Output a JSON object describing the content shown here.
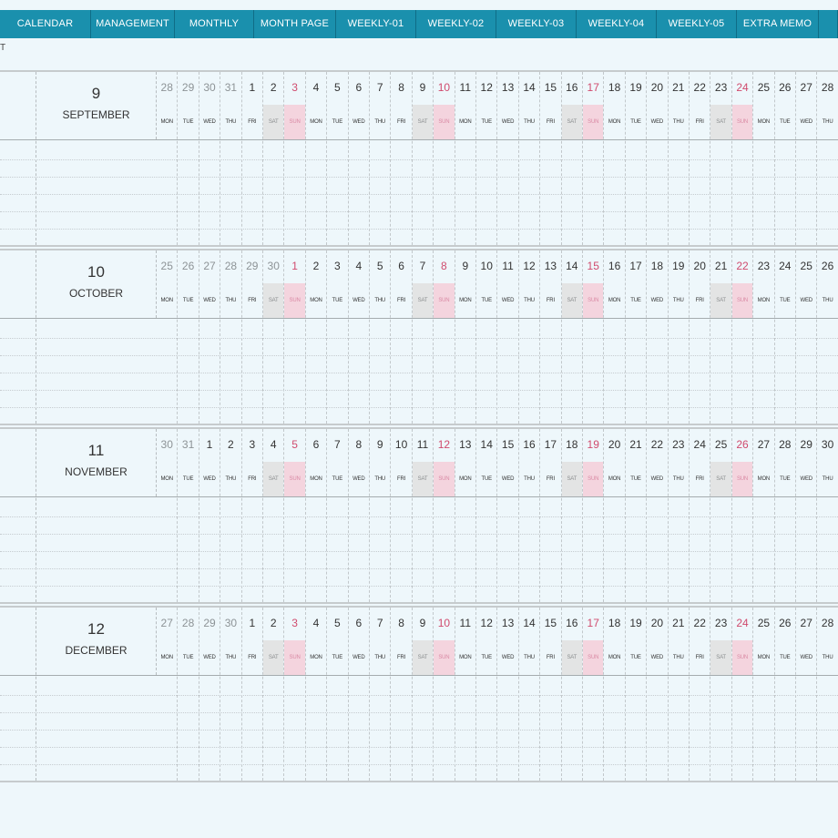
{
  "nav": {
    "tabs": [
      {
        "label": "CALENDAR",
        "w": 100
      },
      {
        "label": "MANAGEMENT",
        "w": 92
      },
      {
        "label": "MONTHLY",
        "w": 87
      },
      {
        "label": "MONTH PAGE",
        "w": 90
      },
      {
        "label": "WEEKLY-01",
        "w": 88
      },
      {
        "label": "WEEKLY-02",
        "w": 88
      },
      {
        "label": "WEEKLY-03",
        "w": 88
      },
      {
        "label": "WEEKLY-04",
        "w": 88
      },
      {
        "label": "WEEKLY-05",
        "w": 88
      },
      {
        "label": "EXTRA MEMO",
        "w": 90
      },
      {
        "label": "",
        "w": 21
      }
    ]
  },
  "edge_label": "T",
  "dow_cycle": [
    "MON",
    "TUE",
    "WED",
    "THU",
    "FRI",
    "SAT",
    "SUN"
  ],
  "months": [
    {
      "number": "9",
      "name": "SEPTEMBER",
      "days": [
        28,
        29,
        30,
        31,
        1,
        2,
        3,
        4,
        5,
        6,
        7,
        8,
        9,
        10,
        11,
        12,
        13,
        14,
        15,
        16,
        17,
        18,
        19,
        20,
        21,
        22,
        23,
        24,
        25,
        26,
        27,
        28
      ],
      "prev_count": 4
    },
    {
      "number": "10",
      "name": "OCTOBER",
      "days": [
        25,
        26,
        27,
        28,
        29,
        30,
        1,
        2,
        3,
        4,
        5,
        6,
        7,
        8,
        9,
        10,
        11,
        12,
        13,
        14,
        15,
        16,
        17,
        18,
        19,
        20,
        21,
        22,
        23,
        24,
        25,
        26
      ],
      "prev_count": 6
    },
    {
      "number": "11",
      "name": "NOVEMBER",
      "days": [
        30,
        31,
        1,
        2,
        3,
        4,
        5,
        6,
        7,
        8,
        9,
        10,
        11,
        12,
        13,
        14,
        15,
        16,
        17,
        18,
        19,
        20,
        21,
        22,
        23,
        24,
        25,
        26,
        27,
        28,
        29,
        30
      ],
      "prev_count": 2
    },
    {
      "number": "12",
      "name": "DECEMBER",
      "days": [
        27,
        28,
        29,
        30,
        1,
        2,
        3,
        4,
        5,
        6,
        7,
        8,
        9,
        10,
        11,
        12,
        13,
        14,
        15,
        16,
        17,
        18,
        19,
        20,
        21,
        22,
        23,
        24,
        25,
        26,
        27,
        28
      ],
      "prev_count": 4
    }
  ]
}
